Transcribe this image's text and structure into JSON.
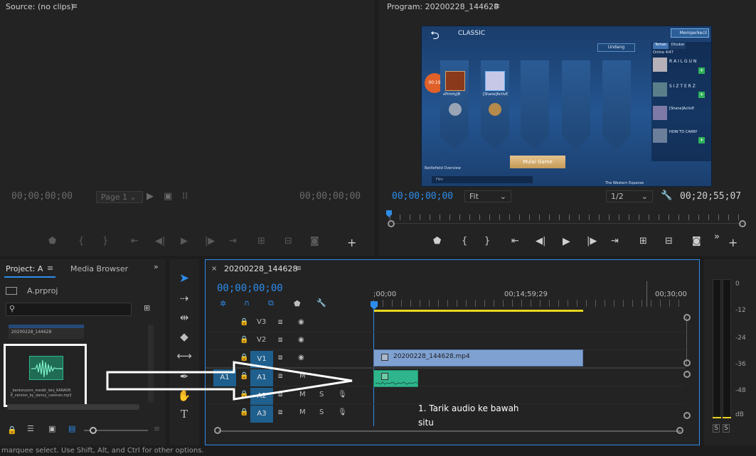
{
  "source_panel": {
    "title": "Source: (no clips)",
    "timecode_left": "00;00;00;00",
    "timecode_right": "00;00;00;00",
    "page_dropdown": "Page 1"
  },
  "program_panel": {
    "title": "Program: 20200228_144628",
    "timecode_left": "00;00;00;00",
    "fit_dropdown": "Fit",
    "res_dropdown": "1/2",
    "timecode_right": "00;20;55;07"
  },
  "game_preview": {
    "mode": "CLASSIC",
    "button_top_right": "Memperkecil",
    "undang": "Undang",
    "tab_teman": "Teman",
    "tab_disukai": "Disukai",
    "online": "Online 4/47",
    "friends": [
      "R A I L G U N",
      "S I Z T E R Z",
      "[Shane]ActivE",
      "HOW TO CARRY"
    ],
    "timer": "00:19",
    "player1": "xPrimtyJB",
    "player2": "[Shane]ActivE",
    "start_button": "Mulai Game",
    "battlefield": "Battlefield Overview",
    "western": "The Western Expanse",
    "chat": "Film"
  },
  "project_panel": {
    "tab_project": "Project: A",
    "tab_media_browser": "Media Browser",
    "project_file": "A.prproj",
    "item1_name": "20200228_144628",
    "item2_name": "_bantonyons_mesbt_lanj_KARAOK E_version_by_danny_calonan.mp3"
  },
  "timeline": {
    "sequence_name": "20200228_144628",
    "timecode": "00;00;00;00",
    "ruler": [
      ";00;00",
      "00;14;59;29",
      "00;30;00"
    ],
    "tracks_video": [
      "V3",
      "V2",
      "V1"
    ],
    "tracks_audio": [
      "A1",
      "A2",
      "A3"
    ],
    "source_patch": "A1",
    "video_clip": "20200228_144628.mp4",
    "annotation_line1": "1. Tarik audio ke bawah",
    "annotation_line2": "situ"
  },
  "meters": {
    "labels": [
      "0",
      "-12",
      "-24",
      "-36",
      "-48",
      "dB"
    ],
    "solo_left": "S",
    "solo_right": "S"
  },
  "status_bar": "marquee select. Use Shift, Alt, and Ctrl for other options.",
  "colors": {
    "accent": "#2d8ceb",
    "video_clip": "#7fa1d1",
    "audio_clip": "#2fb58c",
    "workarea": "#e8d51e"
  }
}
